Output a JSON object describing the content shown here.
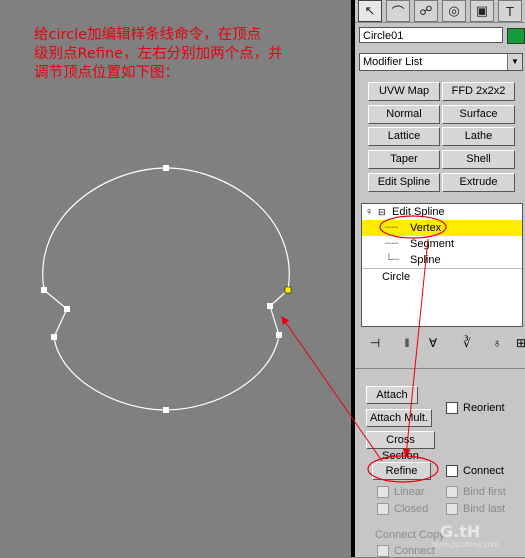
{
  "instruction": "给circle加编辑样条线命令，在顶点\n级别点Refine，左右分别加两个点，并\n调节顶点位置如下图：",
  "toolbar": {
    "tabs": [
      {
        "icon": "arrow-cursor-icon"
      },
      {
        "icon": "bend-icon"
      },
      {
        "icon": "hierarchy-icon"
      },
      {
        "icon": "motion-icon"
      },
      {
        "icon": "display-icon"
      },
      {
        "icon": "utilities-hammer-icon"
      }
    ]
  },
  "object": {
    "name": "Circle01",
    "color": "#179a3a"
  },
  "modifier_list": {
    "label": "Modifier List"
  },
  "modifier_buttons": [
    "UVW Map",
    "FFD 2x2x2",
    "Normal",
    "Surface",
    "Lattice",
    "Lathe",
    "Taper",
    "Shell",
    "Edit Spline",
    "Extrude"
  ],
  "stack": {
    "items": [
      {
        "label": "Edit Spline",
        "level": 0,
        "selected": false
      },
      {
        "label": "Vertex",
        "level": 1,
        "selected": true
      },
      {
        "label": "Segment",
        "level": 1,
        "selected": false
      },
      {
        "label": "Spline",
        "level": 1,
        "selected": false
      },
      {
        "label": "Circle",
        "level": -1,
        "selected": false
      }
    ]
  },
  "geometry": {
    "attach": "Attach",
    "attach_mult": "Attach Mult.",
    "reorient": "Reorient",
    "cross_section": "Cross Section",
    "refine": "Refine",
    "connect": "Connect",
    "linear": "Linear",
    "bind_first": "Bind first",
    "closed": "Closed",
    "bind_last": "Bind last",
    "connect_copy": "Connect Copy",
    "connect2": "Connect"
  },
  "watermark": {
    "main": "G.tH",
    "sub": "www.pptxtime.com"
  },
  "colors": {
    "highlight": "#ffec00",
    "annotation": "#e8000d"
  }
}
